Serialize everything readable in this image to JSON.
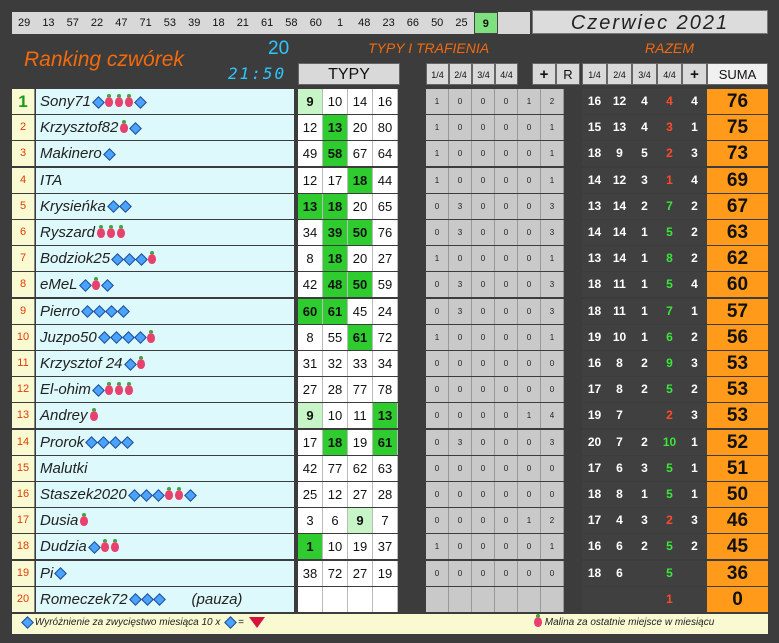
{
  "top_numbers": [
    "29",
    "13",
    "57",
    "22",
    "47",
    "71",
    "53",
    "39",
    "18",
    "21",
    "61",
    "58",
    "60",
    "1",
    "48",
    "23",
    "66",
    "50",
    "25",
    "9"
  ],
  "highlighted_number": "9",
  "month": "Czerwiec 2021",
  "title": "Ranking czwórek",
  "round": "20",
  "time": "21:50",
  "section_typy_trafienia": "TYPY I TRAFIENIA",
  "section_razem": "RAZEM",
  "header": {
    "typy": "TYPY",
    "m_cols": [
      "1/4",
      "2/4",
      "3/4",
      "4/4"
    ],
    "plus": "+",
    "r": "R",
    "razem_cols": [
      "1/4",
      "2/4",
      "3/4",
      "4/4"
    ],
    "razem_plus": "+",
    "suma": "SUMA"
  },
  "rows": [
    {
      "rank": "1",
      "name": "Sony71",
      "dia": 1,
      "ras": 3,
      "dia2": 1,
      "pause": "",
      "typy": [
        "9",
        "10",
        "14",
        "16"
      ],
      "hits": [
        1,
        0,
        0,
        0
      ],
      "m": [
        "1",
        "0",
        "0",
        "0",
        "1",
        "2"
      ],
      "r": [
        "16",
        "12",
        "4",
        "4"
      ],
      "plus": "4",
      "suma": "76"
    },
    {
      "rank": "2",
      "name": "Krzysztof82",
      "dia": 0,
      "ras": 1,
      "dia2": 1,
      "pause": "",
      "typy": [
        "12",
        "13",
        "20",
        "80"
      ],
      "hits": [
        0,
        2,
        0,
        0
      ],
      "m": [
        "1",
        "0",
        "0",
        "0",
        "0",
        "1"
      ],
      "r": [
        "15",
        "13",
        "4",
        "3"
      ],
      "plus": "1",
      "suma": "75"
    },
    {
      "rank": "3",
      "name": "Makinero",
      "dia": 1,
      "ras": 0,
      "dia2": 0,
      "pause": "",
      "typy": [
        "49",
        "58",
        "67",
        "64"
      ],
      "hits": [
        0,
        2,
        0,
        0
      ],
      "m": [
        "1",
        "0",
        "0",
        "0",
        "0",
        "1"
      ],
      "r": [
        "18",
        "9",
        "5",
        "2"
      ],
      "plus": "3",
      "suma": "73"
    },
    {
      "rank": "4",
      "name": "ITA",
      "dia": 0,
      "ras": 0,
      "dia2": 0,
      "pause": "",
      "typy": [
        "12",
        "17",
        "18",
        "44"
      ],
      "hits": [
        0,
        0,
        2,
        0
      ],
      "m": [
        "1",
        "0",
        "0",
        "0",
        "0",
        "1"
      ],
      "r": [
        "14",
        "12",
        "3",
        "1"
      ],
      "plus": "4",
      "suma": "69"
    },
    {
      "rank": "5",
      "name": "Krysieńka",
      "dia": 2,
      "ras": 0,
      "dia2": 0,
      "pause": "",
      "typy": [
        "13",
        "18",
        "20",
        "65"
      ],
      "hits": [
        2,
        2,
        0,
        0
      ],
      "m": [
        "0",
        "3",
        "0",
        "0",
        "0",
        "3"
      ],
      "r": [
        "13",
        "14",
        "2",
        "7"
      ],
      "plus": "2",
      "suma": "67"
    },
    {
      "rank": "6",
      "name": "Ryszard",
      "dia": 0,
      "ras": 3,
      "dia2": 0,
      "pause": "",
      "typy": [
        "34",
        "39",
        "50",
        "76"
      ],
      "hits": [
        0,
        2,
        2,
        0
      ],
      "m": [
        "0",
        "3",
        "0",
        "0",
        "0",
        "3"
      ],
      "r": [
        "14",
        "14",
        "1",
        "5"
      ],
      "plus": "2",
      "suma": "63"
    },
    {
      "rank": "7",
      "name": "Bodziok25",
      "dia": 3,
      "ras": 1,
      "dia2": 0,
      "pause": "",
      "typy": [
        "8",
        "18",
        "20",
        "27"
      ],
      "hits": [
        0,
        2,
        0,
        0
      ],
      "m": [
        "1",
        "0",
        "0",
        "0",
        "0",
        "1"
      ],
      "r": [
        "13",
        "14",
        "1",
        "8"
      ],
      "plus": "2",
      "suma": "62"
    },
    {
      "rank": "8",
      "name": "eMeL",
      "dia": 1,
      "ras": 1,
      "dia2": 1,
      "pause": "",
      "typy": [
        "42",
        "48",
        "50",
        "59"
      ],
      "hits": [
        0,
        2,
        2,
        0
      ],
      "m": [
        "0",
        "3",
        "0",
        "0",
        "0",
        "3"
      ],
      "r": [
        "18",
        "11",
        "1",
        "5"
      ],
      "plus": "4",
      "suma": "60"
    },
    {
      "rank": "9",
      "name": "Pierro",
      "dia": 4,
      "ras": 0,
      "dia2": 0,
      "pause": "",
      "typy": [
        "60",
        "61",
        "45",
        "24"
      ],
      "hits": [
        2,
        2,
        0,
        0
      ],
      "m": [
        "0",
        "3",
        "0",
        "0",
        "0",
        "3"
      ],
      "r": [
        "18",
        "11",
        "1",
        "7"
      ],
      "plus": "1",
      "suma": "57"
    },
    {
      "rank": "10",
      "name": "Juzpo50",
      "dia": 4,
      "ras": 1,
      "dia2": 0,
      "pause": "",
      "typy": [
        "8",
        "55",
        "61",
        "72"
      ],
      "hits": [
        0,
        0,
        2,
        0
      ],
      "m": [
        "1",
        "0",
        "0",
        "0",
        "0",
        "1"
      ],
      "r": [
        "19",
        "10",
        "1",
        "6"
      ],
      "plus": "2",
      "suma": "56"
    },
    {
      "rank": "11",
      "name": "Krzysztof 24",
      "dia": 1,
      "ras": 1,
      "dia2": 0,
      "pause": "",
      "typy": [
        "31",
        "32",
        "33",
        "34"
      ],
      "hits": [
        0,
        0,
        0,
        0
      ],
      "m": [
        "0",
        "0",
        "0",
        "0",
        "0",
        "0"
      ],
      "r": [
        "16",
        "8",
        "2",
        "9"
      ],
      "plus": "3",
      "suma": "53"
    },
    {
      "rank": "12",
      "name": "El-ohim",
      "dia": 1,
      "ras": 3,
      "dia2": 0,
      "pause": "",
      "typy": [
        "27",
        "28",
        "77",
        "78"
      ],
      "hits": [
        0,
        0,
        0,
        0
      ],
      "m": [
        "0",
        "0",
        "0",
        "0",
        "0",
        "0"
      ],
      "r": [
        "17",
        "8",
        "2",
        "5"
      ],
      "plus": "2",
      "suma": "53"
    },
    {
      "rank": "13",
      "name": "Andrey",
      "dia": 0,
      "ras": 1,
      "dia2": 0,
      "pause": "",
      "typy": [
        "9",
        "10",
        "11",
        "13"
      ],
      "hits": [
        1,
        0,
        0,
        2
      ],
      "m": [
        "0",
        "0",
        "0",
        "0",
        "1",
        "4"
      ],
      "r": [
        "19",
        "7",
        "",
        "2"
      ],
      "plus": "3",
      "suma": "53"
    },
    {
      "rank": "14",
      "name": "Prorok",
      "dia": 4,
      "ras": 0,
      "dia2": 0,
      "pause": "",
      "typy": [
        "17",
        "18",
        "19",
        "61"
      ],
      "hits": [
        0,
        2,
        0,
        2
      ],
      "m": [
        "0",
        "3",
        "0",
        "0",
        "0",
        "3"
      ],
      "r": [
        "20",
        "7",
        "2",
        "10"
      ],
      "plus": "1",
      "suma": "52"
    },
    {
      "rank": "15",
      "name": "Malutki",
      "dia": 0,
      "ras": 0,
      "dia2": 0,
      "pause": "",
      "typy": [
        "42",
        "77",
        "62",
        "63"
      ],
      "hits": [
        0,
        0,
        0,
        0
      ],
      "m": [
        "0",
        "0",
        "0",
        "0",
        "0",
        "0"
      ],
      "r": [
        "17",
        "6",
        "3",
        "5"
      ],
      "plus": "1",
      "suma": "51"
    },
    {
      "rank": "16",
      "name": "Staszek2020",
      "dia": 3,
      "ras": 2,
      "dia2": 1,
      "pause": "",
      "typy": [
        "25",
        "12",
        "27",
        "28"
      ],
      "hits": [
        0,
        0,
        0,
        0
      ],
      "m": [
        "0",
        "0",
        "0",
        "0",
        "0",
        "0"
      ],
      "r": [
        "18",
        "8",
        "1",
        "5"
      ],
      "plus": "1",
      "suma": "50"
    },
    {
      "rank": "17",
      "name": "Dusia",
      "dia": 0,
      "ras": 1,
      "dia2": 0,
      "pause": "",
      "typy": [
        "3",
        "6",
        "9",
        "7"
      ],
      "hits": [
        0,
        0,
        1,
        0
      ],
      "m": [
        "0",
        "0",
        "0",
        "0",
        "1",
        "2"
      ],
      "r": [
        "17",
        "4",
        "3",
        "2"
      ],
      "plus": "3",
      "suma": "46"
    },
    {
      "rank": "18",
      "name": "Dudzia",
      "dia": 1,
      "ras": 2,
      "dia2": 0,
      "pause": "",
      "typy": [
        "1",
        "10",
        "19",
        "37"
      ],
      "hits": [
        2,
        0,
        0,
        0
      ],
      "m": [
        "1",
        "0",
        "0",
        "0",
        "0",
        "1"
      ],
      "r": [
        "16",
        "6",
        "2",
        "5"
      ],
      "plus": "2",
      "suma": "45"
    },
    {
      "rank": "19",
      "name": "Pi",
      "dia": 1,
      "ras": 0,
      "dia2": 0,
      "pause": "",
      "typy": [
        "38",
        "72",
        "27",
        "19"
      ],
      "hits": [
        0,
        0,
        0,
        0
      ],
      "m": [
        "0",
        "0",
        "0",
        "0",
        "0",
        "0"
      ],
      "r": [
        "18",
        "6",
        "",
        "5"
      ],
      "plus": "",
      "suma": "36"
    },
    {
      "rank": "20",
      "name": "Romeczek72",
      "dia": 3,
      "ras": 0,
      "dia2": 0,
      "pause": "(pauza)",
      "typy": [
        "",
        "",
        "",
        ""
      ],
      "hits": [
        0,
        0,
        0,
        0
      ],
      "m": [
        "",
        "",
        "",
        "",
        "",
        ""
      ],
      "r": [
        "",
        "",
        "",
        "1"
      ],
      "plus": "",
      "suma": "0"
    }
  ],
  "footer": {
    "left_text": "Wyróżnienie za zwycięstwo miesiąca  10 x",
    "equals": "=",
    "right_text": "Malina za ostatnie miejsce w miesiącu"
  },
  "colors": {
    "orange": "#ff9a1a",
    "green": "#2ecc2e",
    "name_bg": "#ddf9fb"
  }
}
